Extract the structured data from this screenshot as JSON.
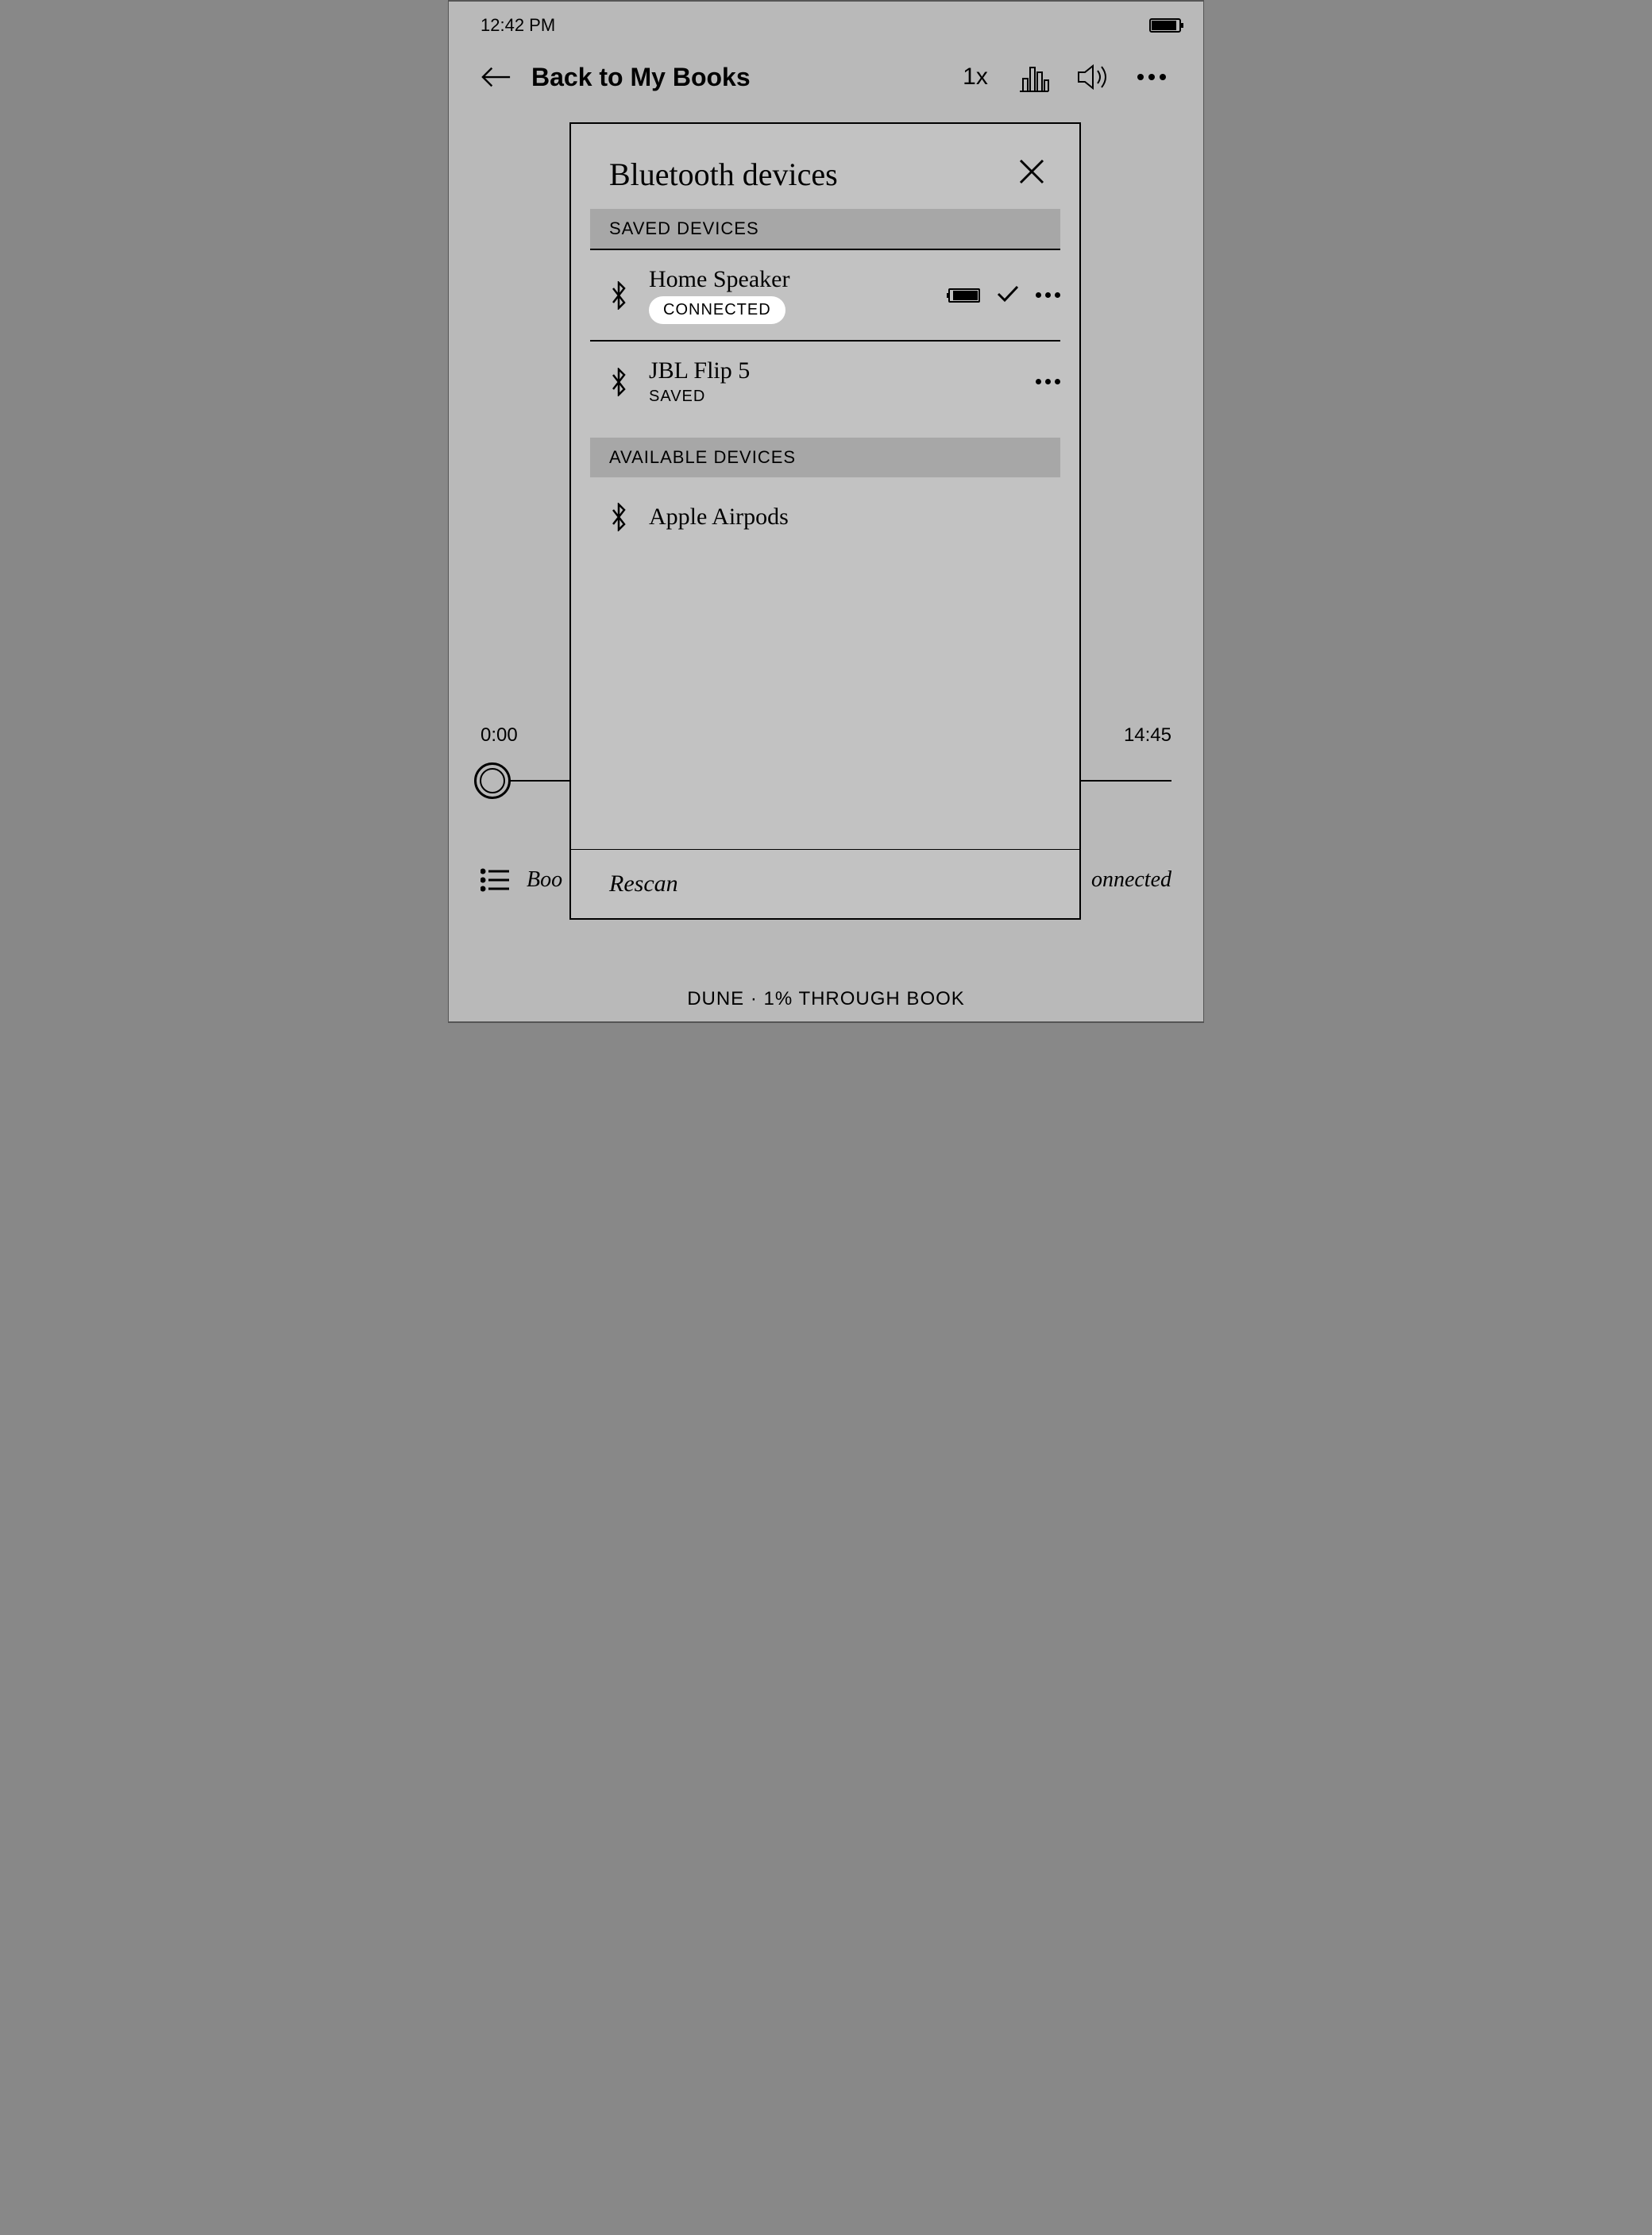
{
  "statusbar": {
    "time": "12:42 PM"
  },
  "toolbar": {
    "back_label": "Back to My Books",
    "speed": "1x"
  },
  "player": {
    "elapsed": "0:00",
    "remaining": "14:45",
    "left_text": "Boo",
    "right_text": "onnected",
    "caption": "DUNE · 1% THROUGH BOOK"
  },
  "modal": {
    "title": "Bluetooth devices",
    "section_saved": "SAVED DEVICES",
    "section_available": "AVAILABLE DEVICES",
    "saved": [
      {
        "name": "Home Speaker",
        "status": "CONNECTED",
        "connected": true
      },
      {
        "name": "JBL Flip 5",
        "status": "SAVED",
        "connected": false
      }
    ],
    "available": [
      {
        "name": "Apple Airpods"
      }
    ],
    "rescan": "Rescan"
  }
}
